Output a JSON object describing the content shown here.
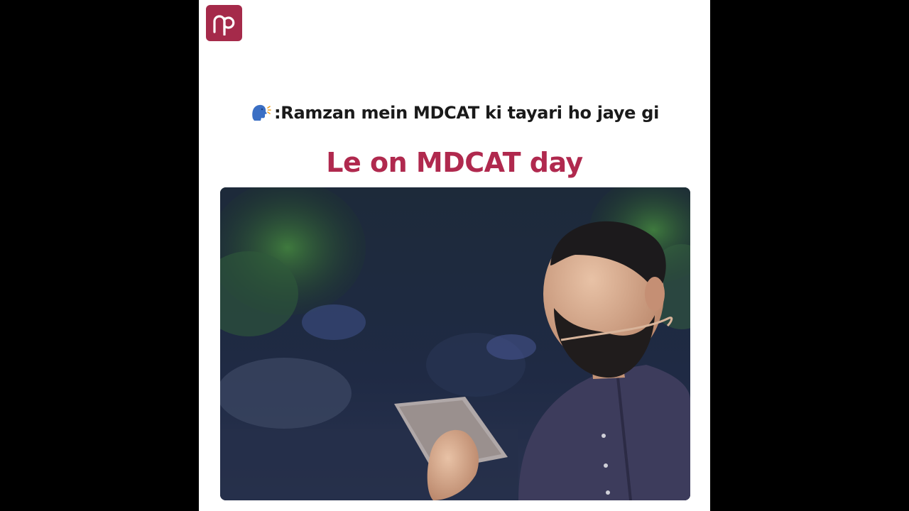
{
  "logo": {
    "text": "np",
    "color": "#a52a4a"
  },
  "caption": {
    "icon": "speaking-head-icon",
    "text": ":Ramzan mein MDCAT ki tayari ho jaye gi"
  },
  "headline": {
    "text": "Le on MDCAT day",
    "color": "#b0294e"
  },
  "video": {
    "subject": "man-holding-tablet-image"
  }
}
